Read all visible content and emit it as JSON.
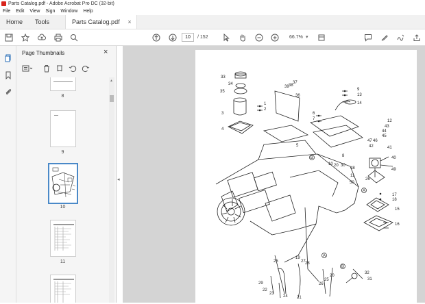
{
  "window": {
    "title": "Parts Catalog.pdf - Adobe Acrobat Pro DC (32-bit)"
  },
  "menu": {
    "items": [
      "File",
      "Edit",
      "View",
      "Sign",
      "Window",
      "Help"
    ]
  },
  "tabs": {
    "home": "Home",
    "tools": "Tools",
    "document": "Parts Catalog.pdf",
    "close": "×"
  },
  "toolbar": {
    "current_page": "10",
    "total_pages": "/ 152",
    "zoom": "66.7%"
  },
  "panel": {
    "title": "Page Thumbnails",
    "thumbnails": [
      {
        "label": "8"
      },
      {
        "label": "9"
      },
      {
        "label": "10"
      },
      {
        "label": "11"
      }
    ]
  },
  "diagram": {
    "callouts": [
      "33",
      "34",
      "35",
      "1",
      "2",
      "3",
      "4",
      "36",
      "37",
      "38",
      "39",
      "5",
      "6",
      "7",
      "8",
      "9",
      "13",
      "14",
      "12",
      "43",
      "44",
      "45",
      "46",
      "47",
      "42",
      "41",
      "40",
      "48",
      "49",
      "11",
      "10",
      "20",
      "30",
      "26",
      "50",
      "25",
      "19",
      "27",
      "28",
      "29",
      "22",
      "23",
      "24",
      "21",
      "26",
      "25",
      "20",
      "32",
      "31",
      "17",
      "18",
      "15",
      "16"
    ],
    "circled": [
      "B",
      "A",
      "A",
      "B"
    ]
  },
  "colors": {
    "accent": "#4a89c8",
    "brand": "#d8251d"
  }
}
